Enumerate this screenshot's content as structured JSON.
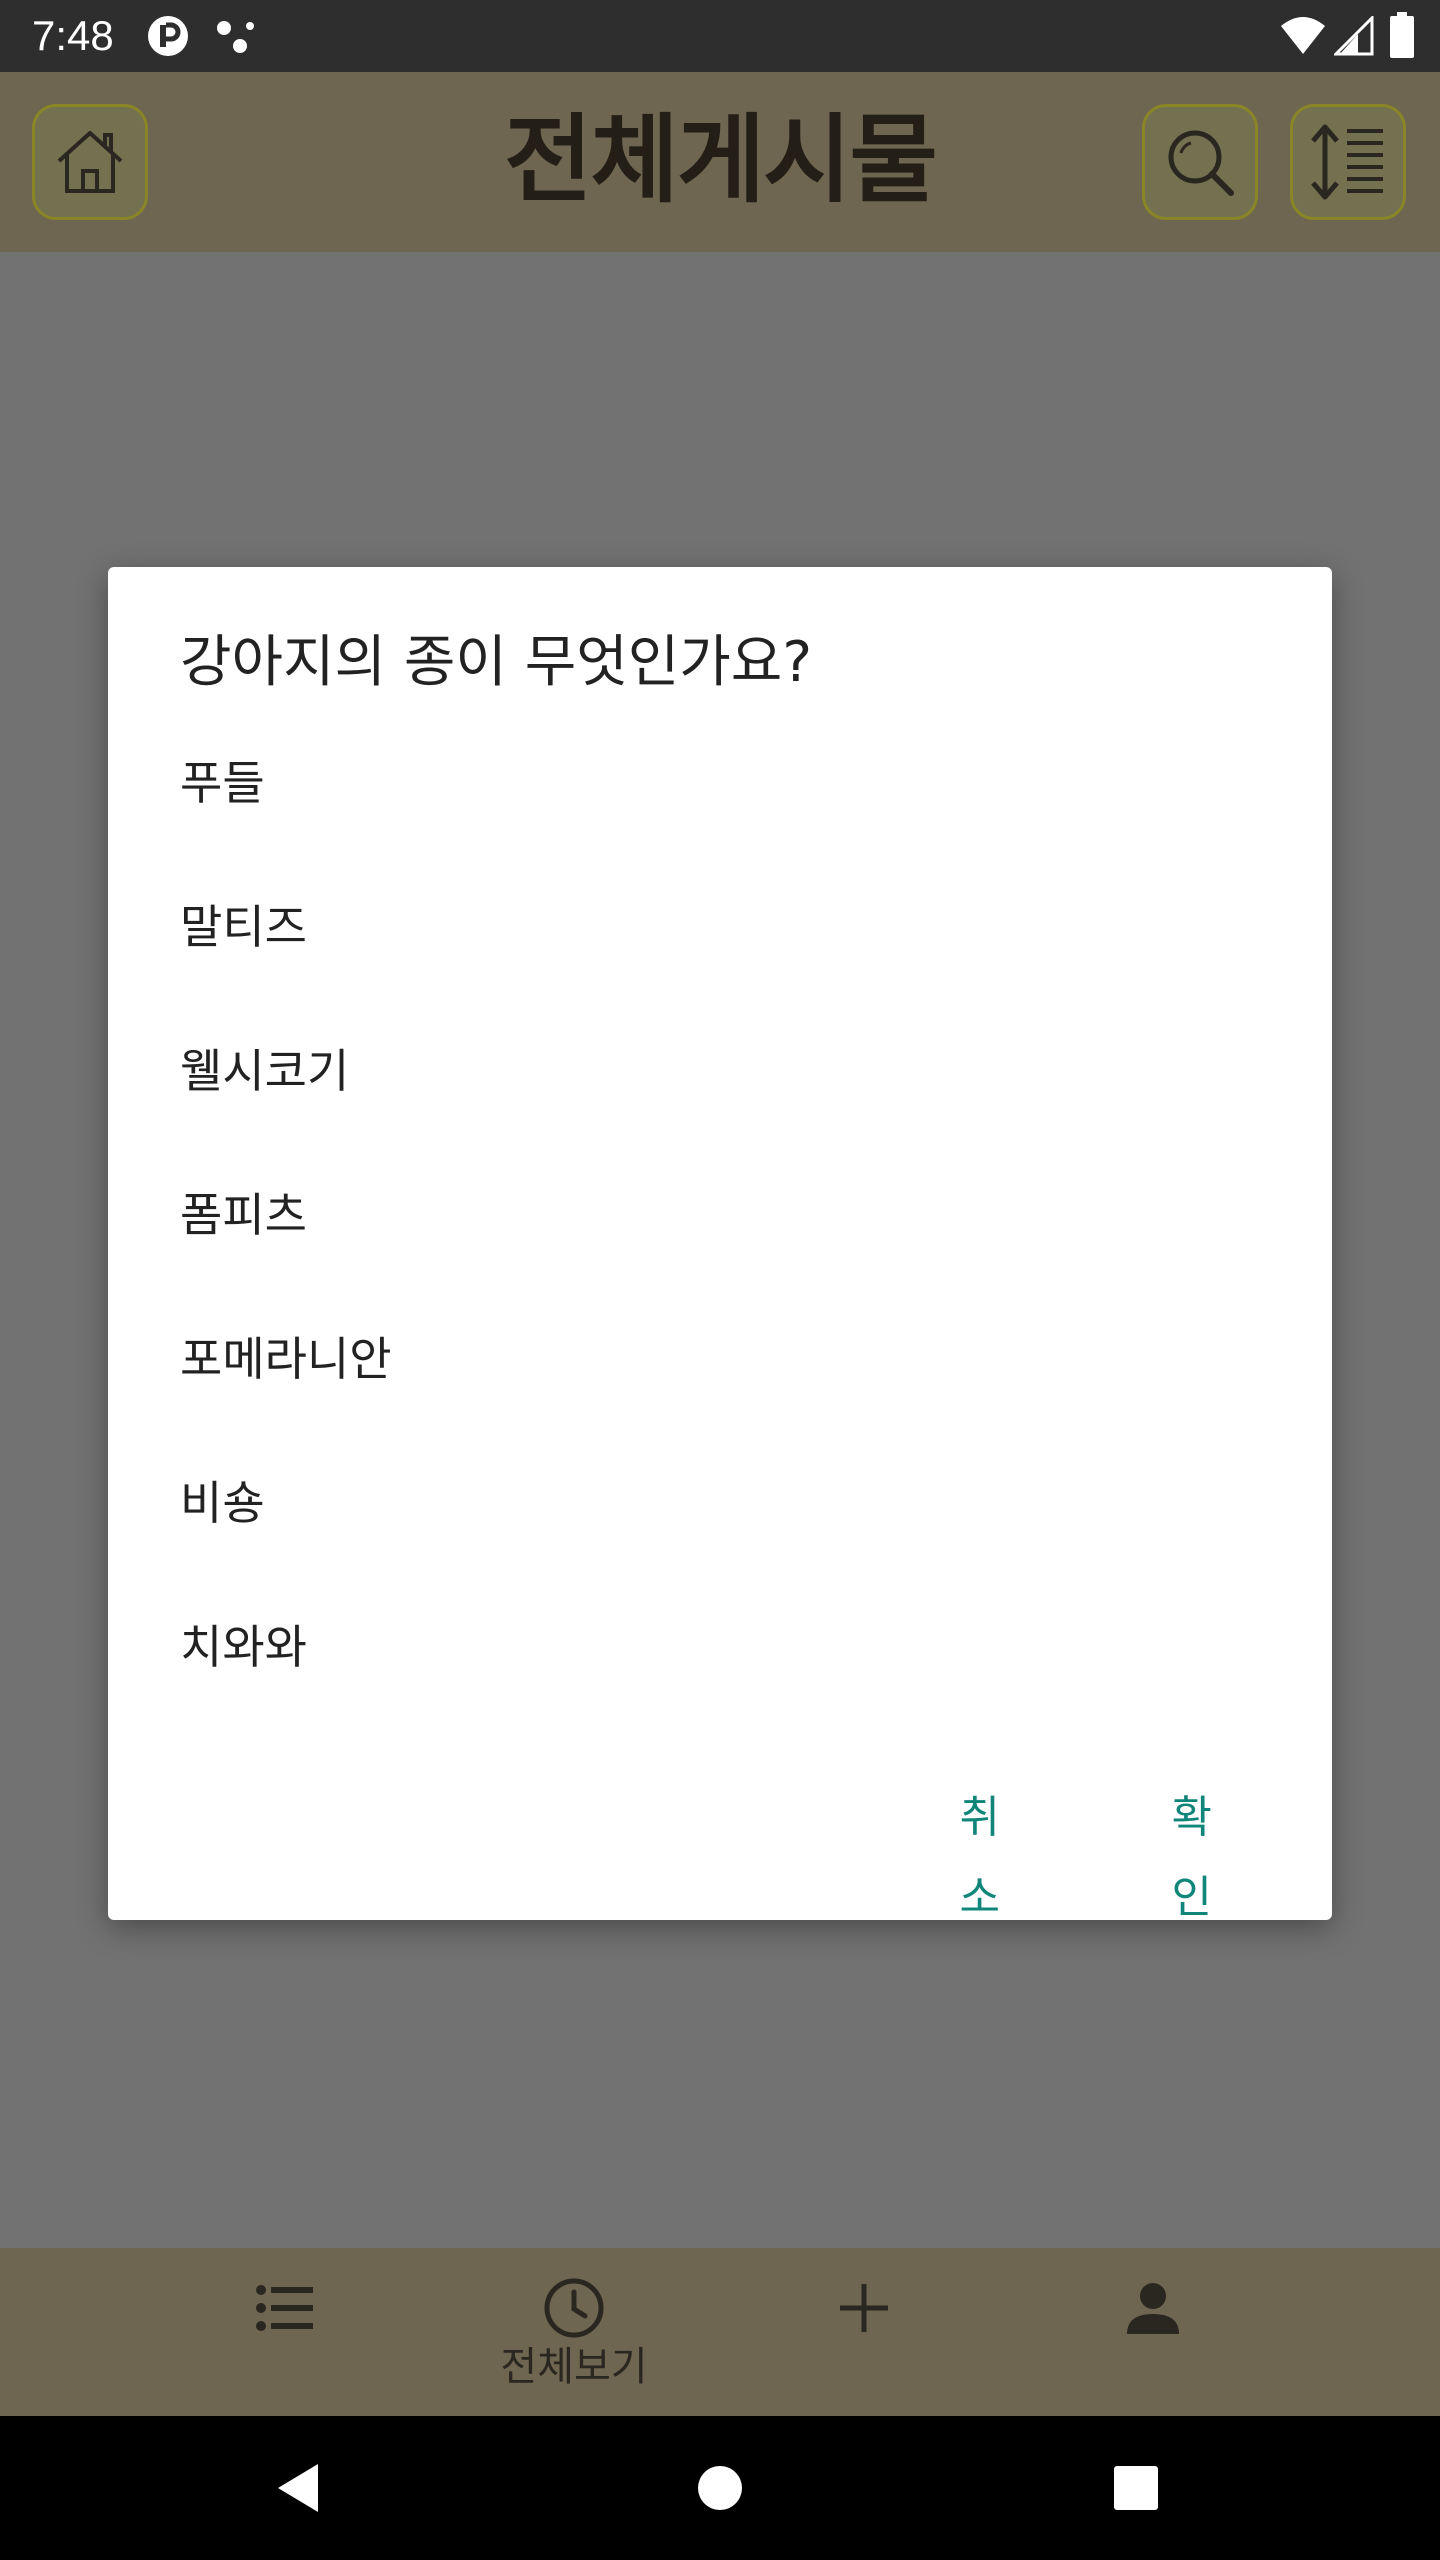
{
  "status_bar": {
    "time": "7:48",
    "icons": [
      "notification-p-icon",
      "notification-dots-icon",
      "wifi-icon",
      "signal-icon",
      "battery-icon"
    ]
  },
  "header": {
    "title": "전체게시물",
    "buttons": [
      "home-icon",
      "search-icon",
      "sort-icon"
    ]
  },
  "dialog": {
    "title": "강아지의 종이 무엇인가요?",
    "options": [
      "푸들",
      "말티즈",
      "웰시코기",
      "폼피츠",
      "포메라니안",
      "비숑",
      "치와와"
    ],
    "cancel_label": "취소",
    "ok_label": "확인",
    "accent_color": "#10857a"
  },
  "bottom_nav": {
    "items": [
      {
        "icon": "list-icon",
        "label": ""
      },
      {
        "icon": "clock-icon",
        "label": "전체보기"
      },
      {
        "icon": "plus-icon",
        "label": ""
      },
      {
        "icon": "person-icon",
        "label": ""
      }
    ]
  },
  "system_nav": [
    "back-icon",
    "home-circle-icon",
    "recent-apps-icon"
  ]
}
